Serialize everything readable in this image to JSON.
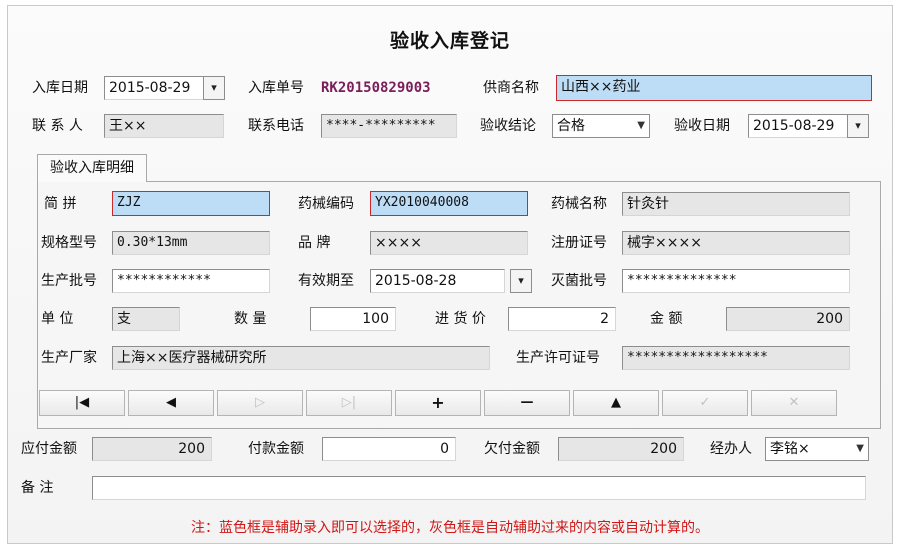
{
  "title": "验收入库登记",
  "header": {
    "stock_in_date_label": "入库日期",
    "stock_in_date_value": "2015-08-29",
    "stock_in_date_btn": "▾",
    "stock_in_no_label": "入库单号",
    "stock_in_no_value": "RK20150829003",
    "supplier_label": "供商名称",
    "supplier_value": "山西××药业",
    "contact_label": "联 系 人",
    "contact_value": "王××",
    "phone_label": "联系电话",
    "phone_value": "****-*********",
    "conclusion_label": "验收结论",
    "conclusion_value": "合格",
    "inspect_date_label": "验收日期",
    "inspect_date_value": "2015-08-29",
    "inspect_date_btn": "▾"
  },
  "detail": {
    "tab_label": "验收入库明细",
    "pinyin_label": "简    拼",
    "pinyin_value": "ZJZ",
    "code_label": "药械编码",
    "code_value": "YX2010040008",
    "name_label": "药械名称",
    "name_value": "针灸针",
    "spec_label": "规格型号",
    "spec_value": "0.30*13mm",
    "brand_label": "品    牌",
    "brand_value": "××××",
    "reg_label": "注册证号",
    "reg_value": "械字××××",
    "batch_label": "生产批号",
    "batch_value": "************",
    "expire_label": "有效期至",
    "expire_value": "2015-08-28",
    "expire_btn": "▾",
    "sterile_label": "灭菌批号",
    "sterile_value": "**************",
    "unit_label": "单    位",
    "unit_value": "支",
    "qty_label": "数    量",
    "qty_value": "100",
    "price_label": "进 货 价",
    "price_value": "2",
    "amount_label": "金    额",
    "amount_value": "200",
    "maker_label": "生产厂家",
    "maker_value": "上海××医疗器械研究所",
    "license_label": "生产许可证号",
    "license_value": "******************"
  },
  "nav": {
    "first": "|◀",
    "prev": "◀",
    "next": "▷",
    "last": "▷|",
    "add": "+",
    "remove": "—",
    "edit": "▲",
    "save": "✓",
    "cancel": "✕"
  },
  "footer": {
    "payable_label": "应付金额",
    "payable_value": "200",
    "paid_label": "付款金额",
    "paid_value": "0",
    "owed_label": "欠付金额",
    "owed_value": "200",
    "handler_label": "经办人",
    "handler_value": "李铭×",
    "remark_label": "备    注",
    "remark_value": ""
  },
  "note": "注：蓝色框是辅助录入即可以选择的，灰色框是自动辅助过来的内容或自动计算的。",
  "colors": {
    "assist_blue": "#bddcf5",
    "auto_gray": "#e6e6e6",
    "note_red": "#d01616"
  }
}
